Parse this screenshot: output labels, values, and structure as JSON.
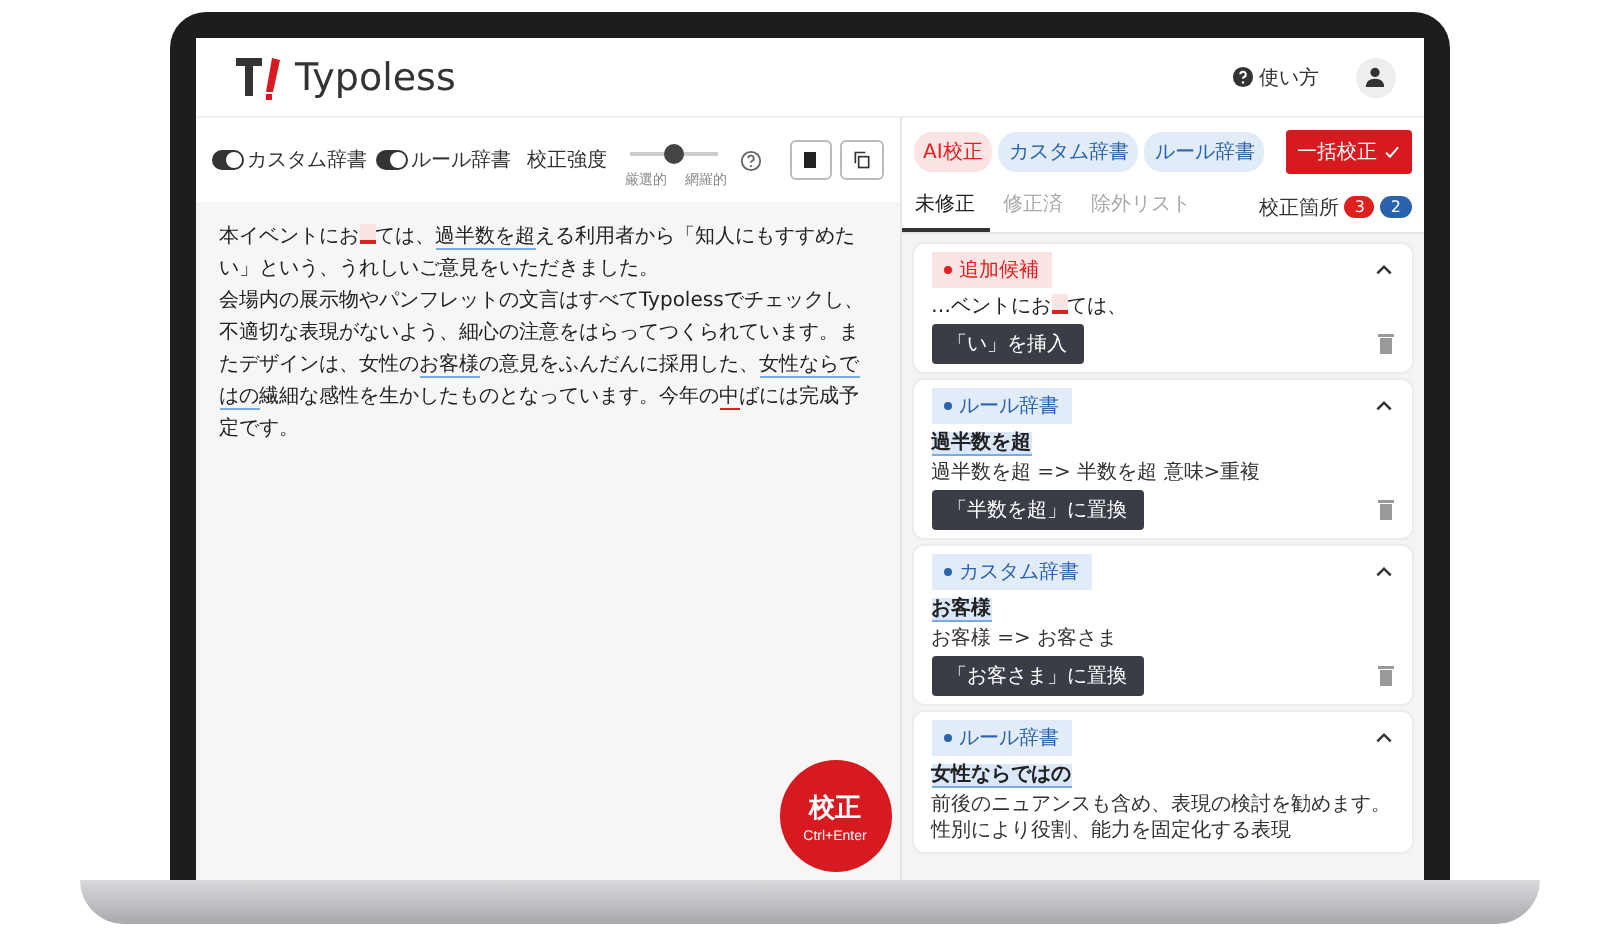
{
  "header": {
    "brand": "Typoless",
    "help_label": "使い方"
  },
  "toolbar": {
    "toggles": [
      {
        "label": "カスタム辞書",
        "on": true
      },
      {
        "label": "ルール辞書",
        "on": true
      }
    ],
    "strength": {
      "label": "校正強度",
      "level": 0.5,
      "min_label": "厳選的",
      "max_label": "網羅的"
    }
  },
  "editor": {
    "paragraphs": [
      [
        {
          "text": "本イベントにお"
        },
        {
          "missing": true
        },
        {
          "text": "ては、"
        },
        {
          "text": "過半数を超",
          "flagged": true
        },
        {
          "text": "える利用者から「知人にもすすめたい」という、うれしいご意見をいただきました。"
        }
      ],
      [
        {
          "text": "会場内の展示物やパンフレットの文言はすべてTypolessでチェックし、不適切な表現がないよう、細心の注意をはらってつくられています。またデザインは、女性の"
        },
        {
          "text": "お客様",
          "flagged": true
        },
        {
          "text": "の意見をふんだんに採用した、"
        },
        {
          "text": "女性ならではの",
          "flagged": true
        },
        {
          "text": "繊細な感性を生かしたものとなっています。今年の"
        },
        {
          "text": "中",
          "error": true
        },
        {
          "text": "ばには完成予定です。"
        }
      ]
    ],
    "run_button": {
      "label": "校正",
      "shortcut": "Ctrl+Enter"
    }
  },
  "panel": {
    "chips": [
      {
        "label": "AI校正",
        "kind": "ai"
      },
      {
        "label": "カスタム辞書",
        "kind": "custom"
      },
      {
        "label": "ルール辞書",
        "kind": "rule"
      }
    ],
    "apply_all": "一括校正",
    "tabs": [
      {
        "label": "未修正",
        "selected": true
      },
      {
        "label": "修正済",
        "selected": false
      },
      {
        "label": "除外リスト",
        "selected": false
      }
    ],
    "count_label": "校正箇所",
    "badges": [
      {
        "count": "3",
        "kind": "ai"
      },
      {
        "count": "2",
        "kind": "rule"
      }
    ],
    "cards": [
      {
        "kind": "ai",
        "tag": "追加候補",
        "expanded": true,
        "segments": [
          {
            "text": "…ベントにお"
          },
          {
            "missing": true
          },
          {
            "text": "ては、"
          }
        ],
        "action": "「い」を挿入"
      },
      {
        "kind": "rule",
        "tag": "ルール辞書",
        "expanded": true,
        "segments": [
          {
            "text": "過半数を超",
            "flagged": true
          }
        ],
        "note": "過半数を超 => 半数を超 意味>重複",
        "action": "「半数を超」に置換"
      },
      {
        "kind": "custom",
        "tag": "カスタム辞書",
        "expanded": true,
        "segments": [
          {
            "text": "お客様",
            "flagged": true
          }
        ],
        "note": "お客様 => お客さま",
        "action": "「お客さま」に置換"
      },
      {
        "kind": "rule",
        "tag": "ルール辞書",
        "expanded": true,
        "segments": [
          {
            "text": "女性ならではの",
            "flagged": true
          }
        ],
        "note": "前後のニュアンスも含め、表現の検討を勧めます。性別により役割、能力を固定化する表現"
      }
    ]
  }
}
